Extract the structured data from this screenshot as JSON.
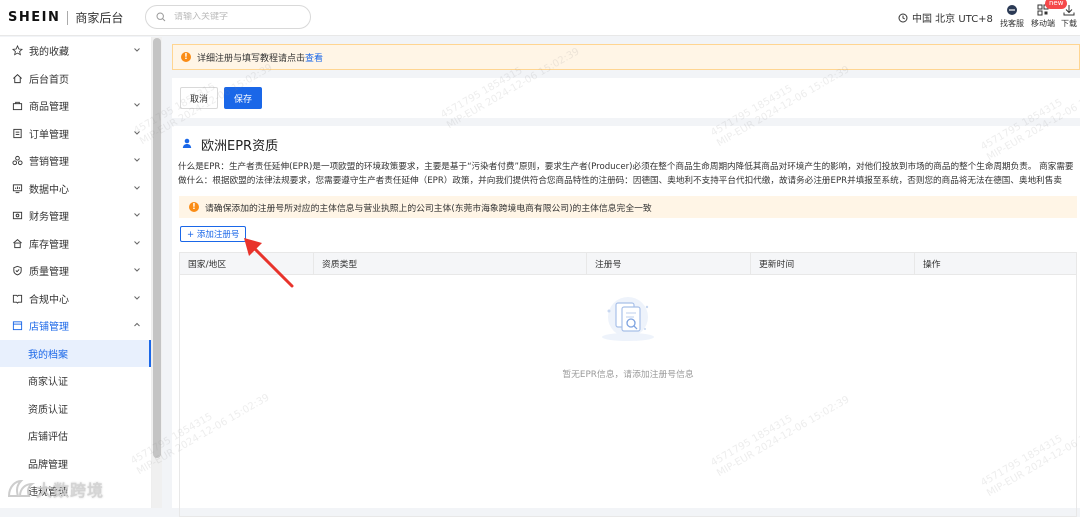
{
  "header": {
    "logo": "SHEIN",
    "subtitle": "商家后台",
    "search_placeholder": "请输入关键字",
    "timezone": "中国 北京 UTC+8",
    "tools": [
      {
        "label": "找客服",
        "icon": "service-icon"
      },
      {
        "label": "移动端",
        "icon": "mobile-qr-icon"
      },
      {
        "label": "下载",
        "icon": "download-icon",
        "badge": "new"
      }
    ]
  },
  "sidebar": {
    "items": [
      {
        "label": "我的收藏",
        "icon": "star-icon",
        "chevron": "down"
      },
      {
        "label": "后台首页",
        "icon": "home-icon"
      },
      {
        "label": "商品管理",
        "icon": "goods-icon",
        "chevron": "down"
      },
      {
        "label": "订单管理",
        "icon": "order-icon",
        "chevron": "down"
      },
      {
        "label": "营销管理",
        "icon": "marketing-icon",
        "chevron": "down"
      },
      {
        "label": "数据中心",
        "icon": "data-icon",
        "chevron": "down"
      },
      {
        "label": "财务管理",
        "icon": "finance-icon",
        "chevron": "down"
      },
      {
        "label": "库存管理",
        "icon": "inventory-icon",
        "chevron": "down"
      },
      {
        "label": "质量管理",
        "icon": "quality-icon",
        "chevron": "down"
      },
      {
        "label": "合规中心",
        "icon": "compliance-icon",
        "chevron": "down"
      },
      {
        "label": "店铺管理",
        "icon": "store-icon",
        "chevron": "up"
      }
    ],
    "sub_items": [
      {
        "label": "我的档案",
        "active": true
      },
      {
        "label": "商家认证"
      },
      {
        "label": "资质认证"
      },
      {
        "label": "店铺评估"
      },
      {
        "label": "品牌管理"
      },
      {
        "label": "违规管理"
      }
    ]
  },
  "notice": {
    "text": "详细注册与填写教程请点击",
    "link": "查看"
  },
  "actions": {
    "cancel": "取消",
    "save": "保存"
  },
  "panel": {
    "title": "欧洲EPR资质",
    "description": "什么是EPR：生产者责任延伸(EPR)是一项欧盟的环境政策要求，主要是基于“污染者付费”原则，要求生产者(Producer)必须在整个商品生命周期内降低其商品对环境产生的影响，对他们投放到市场的商品的整个生命周期负责。 商家需要做什么：根据欧盟的法律法规要求，您需要遵守生产者责任延伸（EPR）政策，并向我们提供符合您商品特性的注册码：因德国、奥地利不支持平台代扣代缴，故请务必注册EPR并填报至系统，否则您的商品将无法在德国、奥地利售卖",
    "info": "请确保添加的注册号所对应的主体信息与营业执照上的公司主体(东莞市海象跨境电商有限公司)的主体信息完全一致",
    "add_button": "+ 添加注册号",
    "table": {
      "columns": [
        "国家/地区",
        "资质类型",
        "注册号",
        "更新时间",
        "操作"
      ],
      "rows": [],
      "empty_text": "暂无EPR信息，请添加注册号信息"
    }
  },
  "watermark": {
    "line1": "4571795 1854315",
    "line2": "MIP-EUR 2024-12-06 15:02:39"
  },
  "brand_overlay": "大数跨境",
  "colors": {
    "primary": "#1a67e8",
    "warning_bg": "#fff5e6",
    "warning_icon": "#fa8c16",
    "annotation_arrow": "#e8332b"
  }
}
